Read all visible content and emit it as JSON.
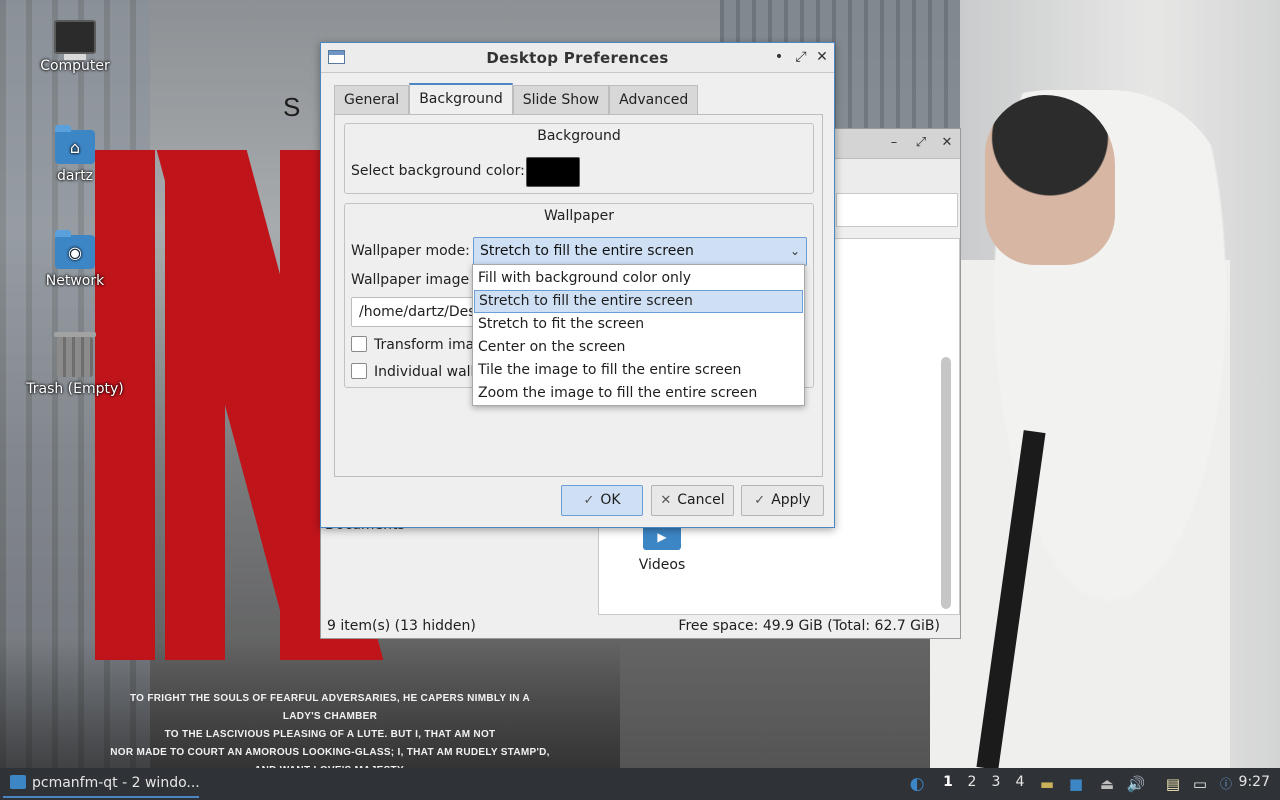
{
  "desktop": {
    "icons": [
      {
        "label": "Computer",
        "icon": "computer-icon"
      },
      {
        "label": "dartz",
        "icon": "home-folder-icon"
      },
      {
        "label": "Network",
        "icon": "network-folder-icon"
      },
      {
        "label": "Trash (Empty)",
        "icon": "trash-icon"
      }
    ],
    "wallpaper": {
      "letters": "S I",
      "quote_lines": [
        "TO FRIGHT THE SOULS OF FEARFUL ADVERSARIES, HE CAPERS NIMBLY IN A LADY'S CHAMBER",
        "TO THE LASCIVIOUS PLEASING OF A LUTE. BUT I, THAT AM NOT",
        "NOR MADE TO COURT AN AMOROUS LOOKING-GLASS; I, THAT AM RUDELY STAMP'D, AND WANT LOVE'S MAJESTY."
      ]
    }
  },
  "file_manager": {
    "side_partial_text": "Documents",
    "video_folder_label": "Videos",
    "status_left": "9 item(s) (13 hidden)",
    "status_right": "Free space: 49.9 GiB (Total: 62.7 GiB)"
  },
  "dialog": {
    "title": "Desktop Preferences",
    "window_buttons": {
      "minimize": "•",
      "maximize": "⤢",
      "close": "✕"
    },
    "tabs": [
      {
        "label": "General",
        "active": false
      },
      {
        "label": "Background",
        "active": true
      },
      {
        "label": "Slide Show",
        "active": false
      },
      {
        "label": "Advanced",
        "active": false
      }
    ],
    "background_group": {
      "title": "Background",
      "color_label": "Select background color:",
      "color_value": "#000000"
    },
    "wallpaper_group": {
      "title": "Wallpaper",
      "mode_label": "Wallpaper mode:",
      "mode_value": "Stretch to fill the entire screen",
      "image_file_label_partial": "Wallpaper image f",
      "image_path_partial": "/home/dartz/Des",
      "transform_label_partial": "Transform ima",
      "individual_label_partial": "Individual wall"
    },
    "mode_options": [
      {
        "label": "Fill with background color only",
        "selected": false
      },
      {
        "label": "Stretch to fill the entire screen",
        "selected": true
      },
      {
        "label": "Stretch to fit the screen",
        "selected": false
      },
      {
        "label": "Center on the screen",
        "selected": false
      },
      {
        "label": "Tile the image to fill the entire screen",
        "selected": false
      },
      {
        "label": "Zoom the image to fill the entire screen",
        "selected": false
      }
    ],
    "buttons": {
      "ok": "OK",
      "cancel": "Cancel",
      "apply": "Apply"
    }
  },
  "taskbar": {
    "task_label": "pcmanfm-qt - 2 windo...",
    "workspaces": [
      "1",
      "2",
      "3",
      "4"
    ],
    "active_workspace": "1",
    "clock": "9:27"
  },
  "colors": {
    "accent": "#4b85c2",
    "selection": "#cfe0f5",
    "taskbar": "#2f3236"
  }
}
